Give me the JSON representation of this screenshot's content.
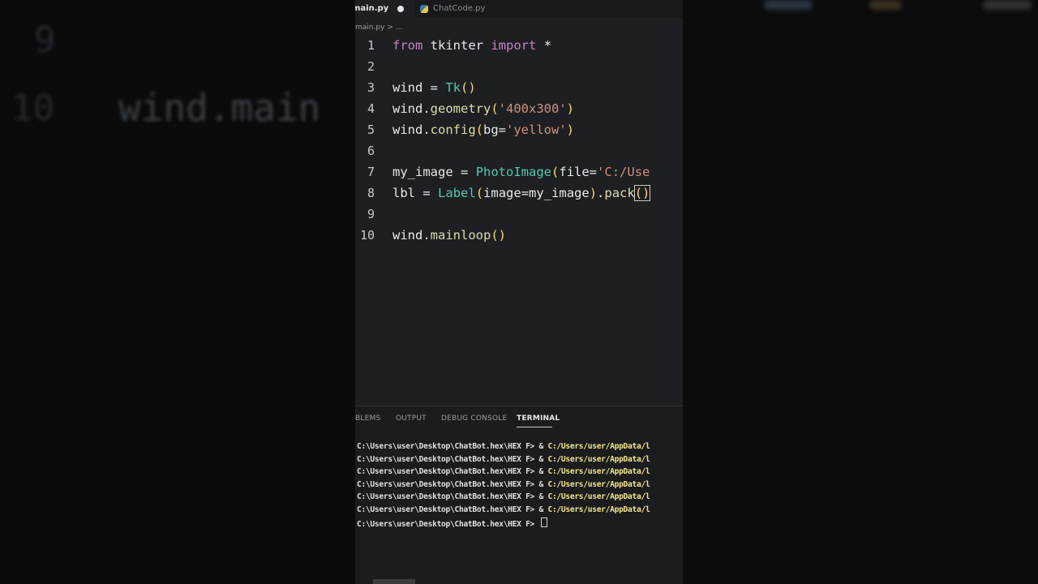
{
  "tabs": {
    "active_label": "main.py",
    "second_label": "ChatCode.py"
  },
  "breadcrumb": {
    "file": "main.py",
    "separator": ">",
    "more": "..."
  },
  "code_lines": [
    {
      "num": "1"
    },
    {
      "num": "2"
    },
    {
      "num": "3"
    },
    {
      "num": "4"
    },
    {
      "num": "5"
    },
    {
      "num": "6"
    },
    {
      "num": "7"
    },
    {
      "num": "8"
    },
    {
      "num": "9"
    },
    {
      "num": "10"
    }
  ],
  "code": {
    "l1": {
      "from": "from",
      "module": "tkinter",
      "import": "import",
      "star": "*"
    },
    "l3": {
      "var": "wind",
      "eq": "=",
      "call": "Tk",
      "parens": "()"
    },
    "l4": {
      "obj": "wind.",
      "method": "geometry",
      "open": "(",
      "arg": "'400x300'",
      "close": ")"
    },
    "l5": {
      "obj": "wind.",
      "method": "config",
      "open": "(",
      "kw": "bg=",
      "arg": "'yellow'",
      "close": ")"
    },
    "l7": {
      "var": "my_image",
      "eq": "=",
      "cls": "PhotoImage",
      "open": "(",
      "kw": "file=",
      "arg": "'C:/Use"
    },
    "l8": {
      "var": "lbl",
      "eq": "=",
      "cls": "Label",
      "open": "(",
      "kw": "image=",
      "val": "my_image",
      "close": ")",
      "dot": ".",
      "method": "pack",
      "parens": "()"
    },
    "l10": {
      "obj": "wind.",
      "method": "mainloop",
      "parens": "()"
    }
  },
  "panel": {
    "tabs": [
      "BLEMS",
      "OUTPUT",
      "DEBUG CONSOLE",
      "TERMINAL"
    ],
    "active_tab": "TERMINAL"
  },
  "terminal": {
    "prompt": "C:\\Users\\user\\Desktop\\ChatBot.hex\\HEX F> ",
    "amp": "& ",
    "path": "C:/Users/user/AppData/l",
    "lines": 6
  },
  "background": {
    "left_line_9": "9",
    "left_line_10": "10",
    "left_code": "wind.main"
  },
  "colors": {
    "keyword": "#c586c0",
    "class": "#4ec9b0",
    "function": "#dcdcaa",
    "string": "#ce9178",
    "bracket": "#f6d96b",
    "terminal_path": "#f2e58a",
    "editor_bg": "#1e1f22"
  }
}
